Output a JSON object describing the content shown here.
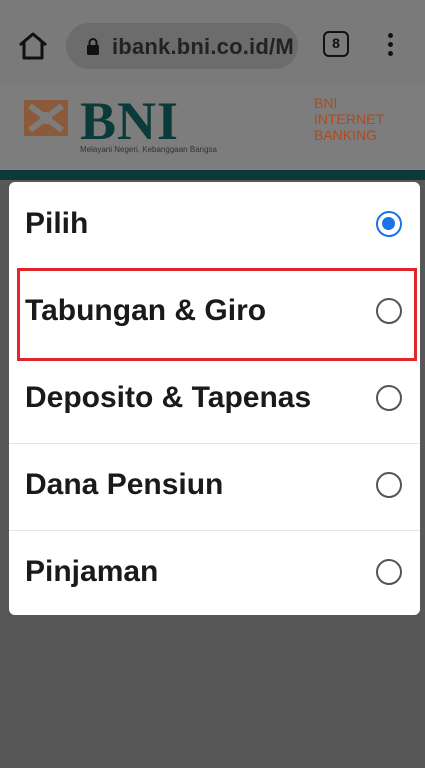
{
  "browser": {
    "url": "ibank.bni.co.id/M",
    "tab_count": "8",
    "icons": {
      "home": "home-icon",
      "lock": "lock-icon",
      "menu": "more-vert-icon"
    }
  },
  "header": {
    "logo_text": "BNI",
    "tagline": "Melayani Negeri, Kebanggaan Bangsa",
    "service_label": [
      "BNI",
      "INTERNET",
      "BANKING"
    ],
    "brand_color": "#0a3a3a",
    "accent_color": "#e4711d"
  },
  "dialog": {
    "options": [
      {
        "label": "Pilih",
        "selected": true
      },
      {
        "label": "Tabungan & Giro",
        "selected": false,
        "highlighted": true
      },
      {
        "label": "Deposito & Tapenas",
        "selected": false
      },
      {
        "label": "Dana Pensiun",
        "selected": false
      },
      {
        "label": "Pinjaman",
        "selected": false
      }
    ],
    "highlight_color": "#e0262b",
    "radio_color": "#1a73e8"
  }
}
